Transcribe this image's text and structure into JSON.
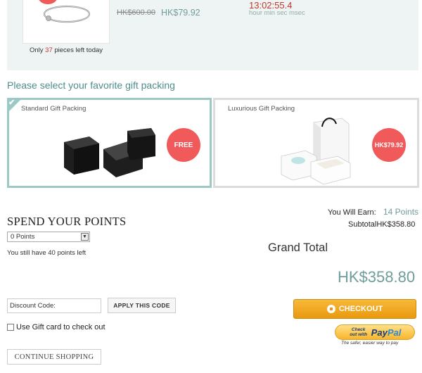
{
  "upsell": {
    "stock_prefix": "Only",
    "stock_count": "37",
    "stock_suffix": "pieces left today",
    "old_price": "HK$600.00",
    "new_price": "HK$79.92",
    "countdown": "13:02:55.4",
    "countdown_units": "hour min sec msec"
  },
  "gift_packing": {
    "heading": "Please select your favorite gift packing",
    "options": [
      {
        "label": "Standard Gift Packing",
        "price": "FREE",
        "selected": true
      },
      {
        "label": "Luxurious Gift Packing",
        "price": "HK$79.92",
        "selected": false
      }
    ]
  },
  "points": {
    "heading": "SPEND YOUR POINTS",
    "selected": "0 Points",
    "remaining_text": "You still have 40 points left"
  },
  "summary": {
    "earn_label": "You Will Earn:",
    "earn_value": "14 Points",
    "subtotal": "SubtotalHK$358.80",
    "grand_total_label": "Grand Total",
    "grand_total_value": "HK$358.80"
  },
  "discount": {
    "value": "Discount Code:",
    "apply_label": "APPLY THIS CODE"
  },
  "gift_card": {
    "label": "Use Gift card to check out"
  },
  "continue_label": "CONTINUE SHOPPING",
  "checkout_label": "CHECKOUT",
  "paypal": {
    "check_out_with": "Check out with",
    "logo_pay": "Pay",
    "logo_pal": "Pal",
    "tagline": "The safer, easier way to pay"
  },
  "colors": {
    "accent": "#6f9d9c",
    "sale_red": "#f05a5a",
    "checkout_orange": "#f0a526"
  }
}
